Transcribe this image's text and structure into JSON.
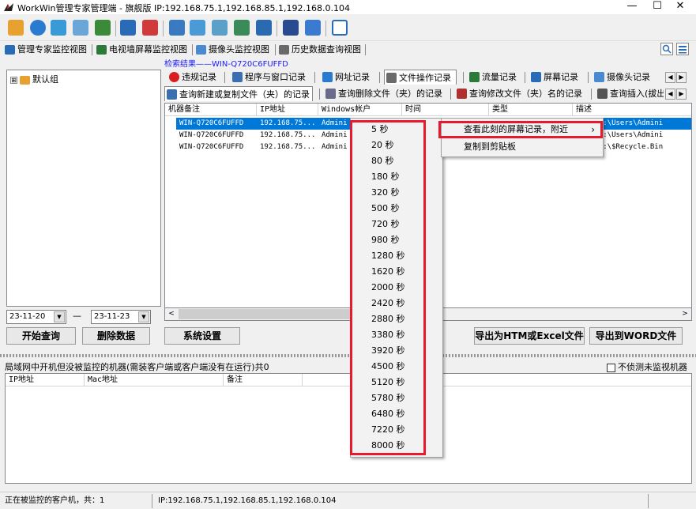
{
  "window": {
    "title": "WorkWin管理专家管理端 - 旗舰版 IP:192.168.75.1,192.168.85.1,192.168.0.104",
    "min": "—",
    "max": "☐",
    "close": "✕"
  },
  "view_tabs": [
    {
      "label": "管理专家监控视图",
      "icon": "monitor-view-icon",
      "color": "#2a6bb8"
    },
    {
      "label": "电视墙屏幕监控视图",
      "icon": "video-wall-icon",
      "color": "#2b7a3a"
    },
    {
      "label": "摄像头监控视图",
      "icon": "camera-icon",
      "color": "#4a8ad0"
    },
    {
      "label": "历史数据查询视图",
      "icon": "history-icon",
      "color": "#6a6a6a"
    }
  ],
  "tree": {
    "root_label": "默认组",
    "expand": "⊞"
  },
  "results_label": "检索结果——WIN-Q720C6FUFFD",
  "tabs_row1": [
    {
      "label": "违规记录",
      "icon": "violation-icon",
      "color": "#d81e1e"
    },
    {
      "label": "程序与窗口记录",
      "icon": "program-window-icon",
      "color": "#3a6fb0"
    },
    {
      "label": "网址记录",
      "icon": "url-icon",
      "color": "#2a7ad0"
    },
    {
      "label": "文件操作记录",
      "icon": "file-op-icon",
      "color": "#6a6a6a"
    },
    {
      "label": "流量记录",
      "icon": "traffic-icon",
      "color": "#2b7a3a"
    },
    {
      "label": "屏幕记录",
      "icon": "screen-record-icon",
      "color": "#2a6bb8"
    },
    {
      "label": "摄像头记录",
      "icon": "camera-record-icon",
      "color": "#4a8ad0"
    }
  ],
  "tabs_row2": [
    {
      "label": "查询新建或复制文件（夹）的记录",
      "icon": "query-new-copy-icon",
      "color": "#3a6fb0"
    },
    {
      "label": "查询删除文件（夹）的记录",
      "icon": "query-delete-icon",
      "color": "#6a6a8a"
    },
    {
      "label": "查询修改文件（夹）名的记录",
      "icon": "query-rename-icon",
      "color": "#b03030"
    },
    {
      "label": "查询插入(拔出)",
      "icon": "query-usb-icon",
      "color": "#555"
    }
  ],
  "arrows": {
    "left": "◀",
    "right": "▶"
  },
  "grid": {
    "columns": [
      "机器备注",
      "IP地址",
      "Windows帐户",
      "时间",
      "类型",
      "描述"
    ],
    "rows": [
      {
        "machine": "WIN-Q720C6FUFFD",
        "ip": "192.168.75...",
        "account": "Admini",
        "desc": "件夹: C:\\Users\\Admini"
      },
      {
        "machine": "WIN-Q720C6FUFFD",
        "ip": "192.168.75...",
        "account": "Admini",
        "desc": "件夹: C:\\Users\\Admini"
      },
      {
        "machine": "WIN-Q720C6FUFFD",
        "ip": "192.168.75...",
        "account": "Admini",
        "desc": "件夹: C:\\$Recycle.Bin"
      }
    ]
  },
  "scroll": {
    "left": "<",
    "right": ">"
  },
  "date_from": "23-11-20",
  "date_to": "23-11-23",
  "date_dash": "—",
  "dropdown": "▼",
  "buttons": {
    "start_query": "开始查询",
    "delete_data": "删除数据",
    "system_settings": "系统设置",
    "export_htm": "导出为HTM或Excel文件",
    "export_word": "导出到WORD文件"
  },
  "context_menu": {
    "items": [
      "5 秒",
      "20 秒",
      "80 秒",
      "180 秒",
      "320 秒",
      "500 秒",
      "720 秒",
      "980 秒",
      "1280 秒",
      "1620 秒",
      "2000 秒",
      "2420 秒",
      "2880 秒",
      "3380 秒",
      "3920 秒",
      "4500 秒",
      "5120 秒",
      "5780 秒",
      "6480 秒",
      "7220 秒",
      "8000 秒"
    ]
  },
  "submenu": {
    "view_screen": "查看此刻的屏幕记录，附近",
    "arrow": "›",
    "copy": "复制到剪贴板"
  },
  "bottom": {
    "label": "局域网中开机但没被监控的机器(需装客户端或客户端没有在运行)共0",
    "checkbox_label": "不侦测未监视机器",
    "columns": [
      "IP地址",
      "Mac地址",
      "备注"
    ]
  },
  "status": {
    "clients": "正在被监控的客户机，共：1",
    "ip": "IP:192.168.75.1,192.168.85.1,192.168.0.104"
  },
  "colors": {
    "selection": "#0078d7",
    "highlight": "#e8192c"
  }
}
